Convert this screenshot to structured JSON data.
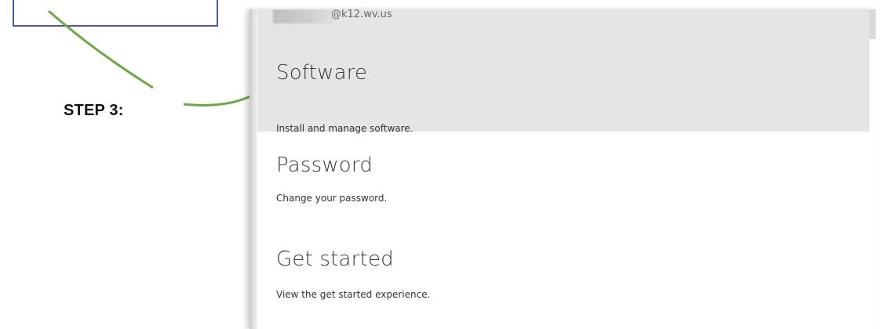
{
  "annotation": {
    "step_label": "STEP 3:",
    "arrow_color": "#6aaa43",
    "box_color": "#4a56b0"
  },
  "account": {
    "email": "@k12.wv.us"
  },
  "menu": {
    "items": [
      {
        "title": "Software",
        "description": "Install and manage software.",
        "selected": true
      },
      {
        "title": "Password",
        "description": "Change your password.",
        "selected": false
      },
      {
        "title": "Get started",
        "description": "View the get started experience.",
        "selected": false
      }
    ]
  },
  "colors": {
    "selected_bg": "#e5e5e5",
    "panel_bg": "#ffffff"
  }
}
